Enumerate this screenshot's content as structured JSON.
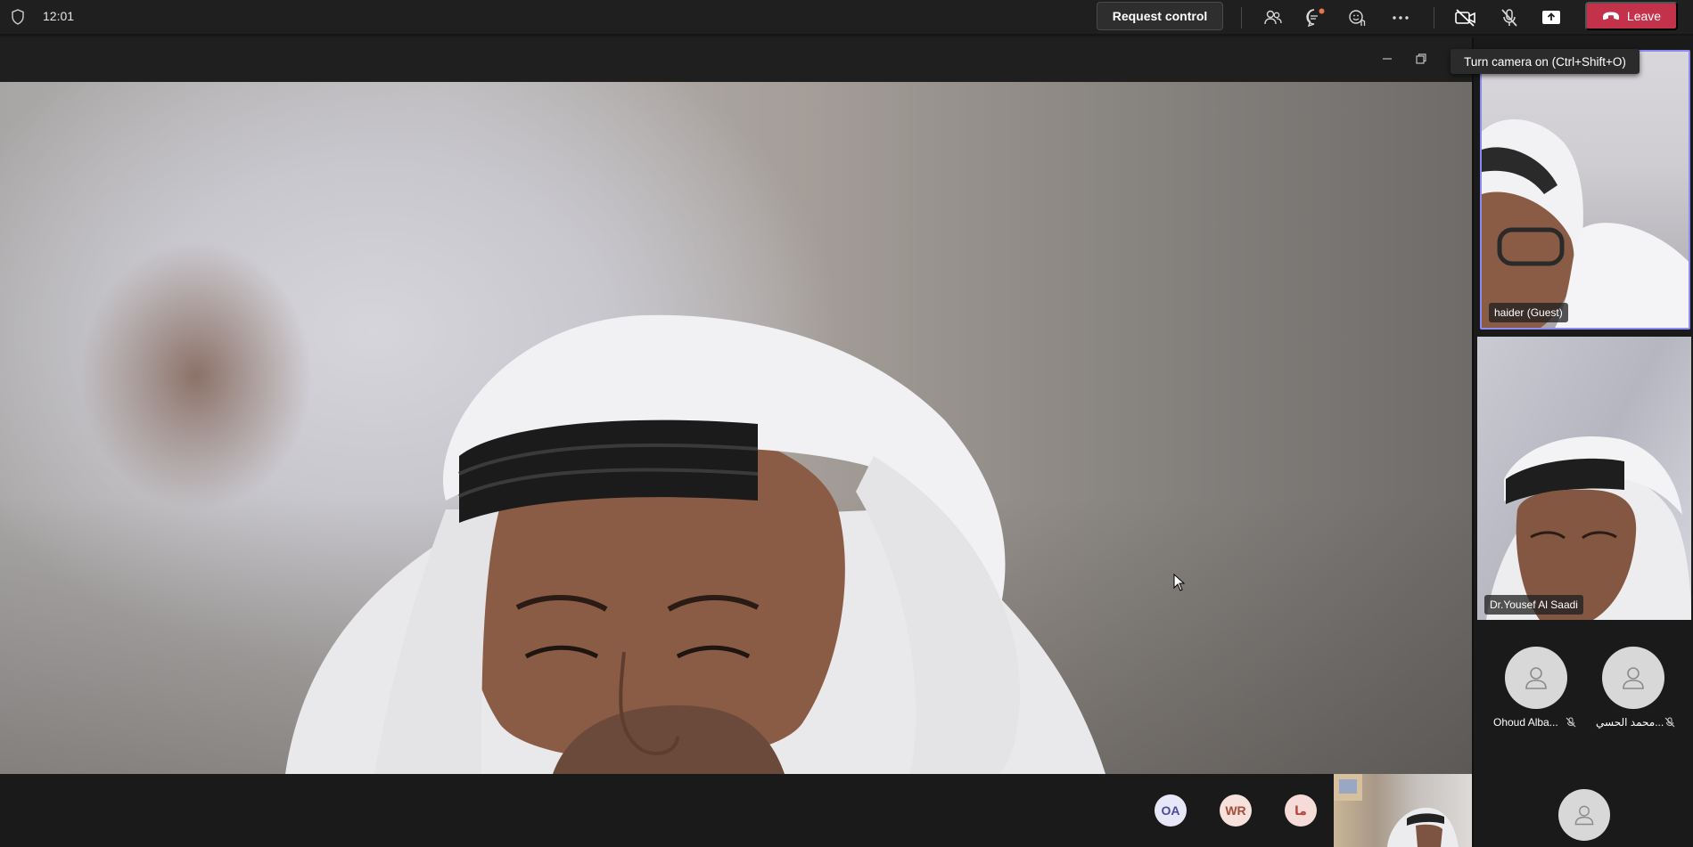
{
  "header": {
    "time": "12:01",
    "request_control_label": "Request control",
    "leave_label": "Leave",
    "icons": [
      "shield-icon",
      "people-icon",
      "chat-icon",
      "reactions-icon",
      "more-icon",
      "camera-off-icon",
      "mic-off-icon",
      "share-icon",
      "phone-hangup-icon"
    ]
  },
  "tooltip": {
    "text": "Turn camera on (Ctrl+Shift+O)"
  },
  "participants": {
    "tile1_name": "haider (Guest)",
    "tile2_name": "Dr.Yousef Al Saadi",
    "audio": [
      {
        "name": "Ohoud Alba..."
      },
      {
        "name": "محمد الحسي..."
      }
    ]
  },
  "bottom_avatars": [
    {
      "initials": "OA",
      "bg": "#e8e7f8",
      "fg": "#4b4a9a"
    },
    {
      "initials": "WR",
      "bg": "#f6e1dc",
      "fg": "#a84c38"
    },
    {
      "initials": "ما",
      "bg": "#f6dcd8",
      "fg": "#b5463a"
    }
  ],
  "colors": {
    "leave": "#c4314b",
    "active_border": "#8a8bf0",
    "topbar": "#201f1f"
  }
}
